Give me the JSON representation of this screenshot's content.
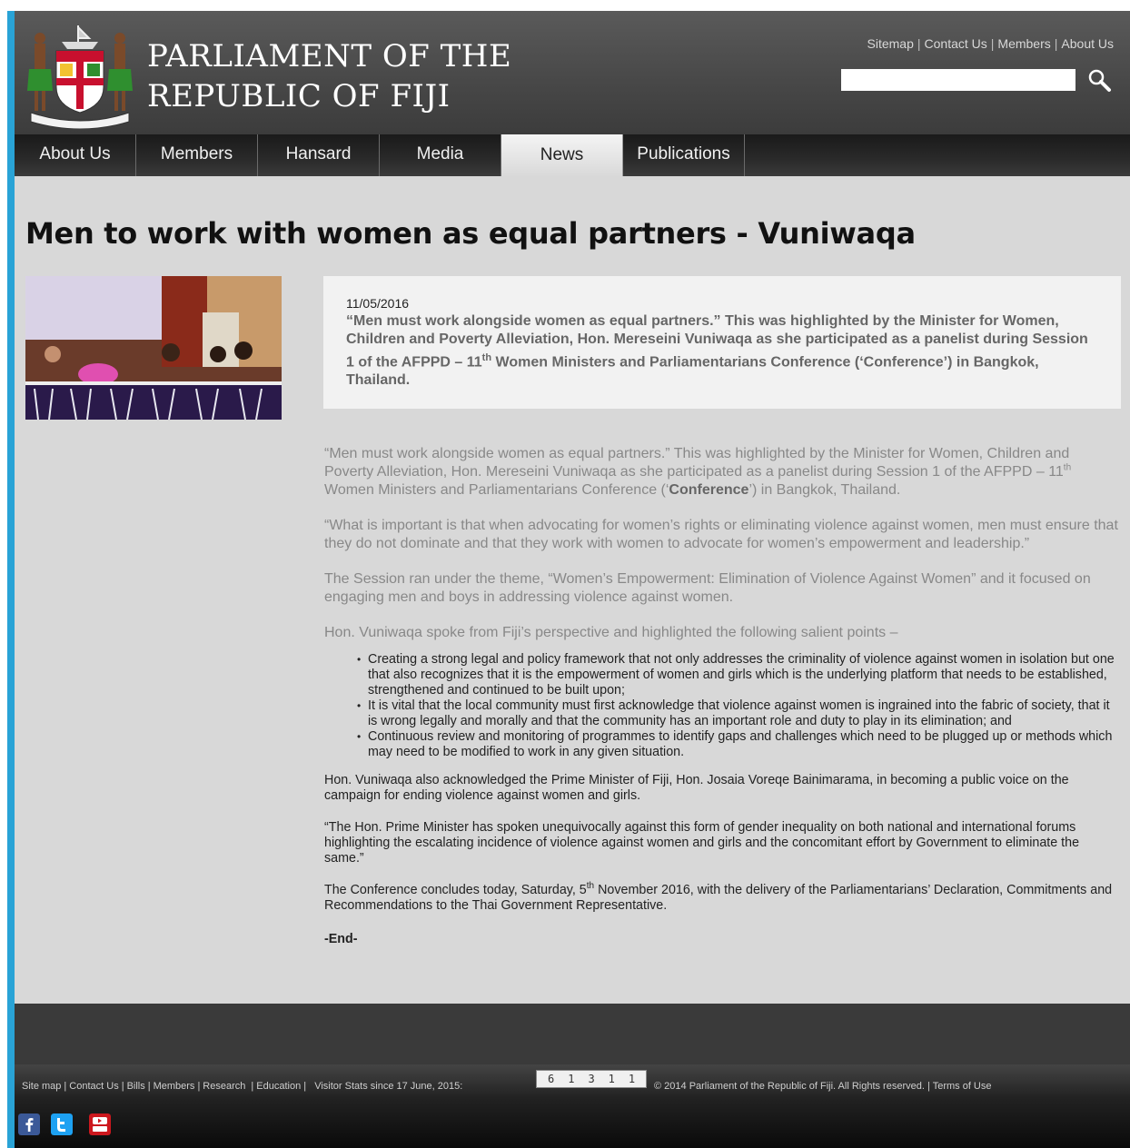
{
  "site": {
    "title_line1": "PARLIAMENT OF THE",
    "title_line2": "REPUBLIC OF FIJI"
  },
  "top_links": [
    "Sitemap",
    "Contact Us",
    "Members",
    "About Us"
  ],
  "search": {
    "placeholder": "",
    "value": ""
  },
  "nav": {
    "items": [
      "About Us",
      "Members",
      "Hansard",
      "Media",
      "News",
      "Publications"
    ],
    "active": "News"
  },
  "article": {
    "title": "Men to work with women as equal partners - Vuniwaqa",
    "date": "11/05/2016",
    "lead_a": "“Men must work alongside women as equal partners.” This was highlighted by the Minister for Women, Children and Poverty Alleviation, Hon. Mereseini Vuniwaqa as she participated as a panelist during Session 1 of the AFPPD – 11",
    "lead_sup": "th",
    "lead_b": " Women Ministers and Parliamentarians Conference (‘Conference’) in Bangkok, Thailand.",
    "p1_a": "“Men must work alongside women as equal partners.” This was highlighted by the Minister for Women, Children and Poverty Alleviation, Hon. Mereseini Vuniwaqa as she participated as a panelist during Session 1 of the AFPPD – 11",
    "p1_sup": "th",
    "p1_b": " Women Ministers and Parliamentarians Conference (‘",
    "p1_bold": "Conference",
    "p1_c": "’) in Bangkok, Thailand.",
    "p2": "“What is important is that when advocating for women’s rights or eliminating violence against women, men must ensure that they do not dominate and that they work with women to advocate for women’s empowerment and leadership.”",
    "p3": "The Session ran under the theme, “Women’s Empowerment: Elimination of Violence Against Women” and it focused on engaging men and boys in addressing violence against women.",
    "p4": "Hon. Vuniwaqa spoke from Fiji’s perspective and highlighted the following salient points –",
    "bullets": [
      "Creating a strong legal and policy framework that not only addresses the criminality of violence against women in isolation but one that also recognizes that it is the empowerment of women and girls which is the underlying platform that needs to be established, strengthened and continued to be built upon;",
      "It is vital that the local community must first acknowledge that violence against women is ingrained into the fabric of society, that it is wrong legally and morally and that the community has an important role and duty to play in its elimination; and",
      "Continuous review and monitoring of programmes to identify gaps and challenges which need to be plugged up or methods which may need to be modified to work in any given situation."
    ],
    "p5": "Hon. Vuniwaqa also acknowledged the Prime Minister of Fiji, Hon. Josaia Voreqe Bainimarama, in becoming a public voice on the campaign for ending violence against women and girls.",
    "p6": "“The Hon. Prime Minister has spoken unequivocally against this form of gender inequality on both national and international forums highlighting the escalating incidence of violence against women and girls and the concomitant effort by Government to eliminate the same.”",
    "p7_a": "The Conference concludes today, Saturday, 5",
    "p7_sup": "th",
    "p7_b": " November 2016, with the delivery of the Parliamentarians’ Declaration, Commitments and Recommendations to the Thai Government Representative.",
    "end": "-End-"
  },
  "footer": {
    "links": [
      "Site map",
      "Contact Us",
      "Bills",
      "Members",
      "Research",
      "Education"
    ],
    "visitor_label": "Visitor Stats since 17 June, 2015:",
    "visitor_count": "61311",
    "copyright": "© 2014 Parliament of the Republic of Fiji. All Rights reserved.",
    "terms": "Terms of Use"
  },
  "colors": {
    "header_bg": "#4a4a4a",
    "accent": "#29a3d6",
    "content_bg": "#d8d8d8",
    "facebook": "#3b5998",
    "twitter": "#1da1f2",
    "youtube": "#cc181e"
  },
  "icons": {
    "search": "magnifier-icon",
    "social": [
      "facebook-icon",
      "twitter-icon",
      "youtube-icon"
    ]
  }
}
